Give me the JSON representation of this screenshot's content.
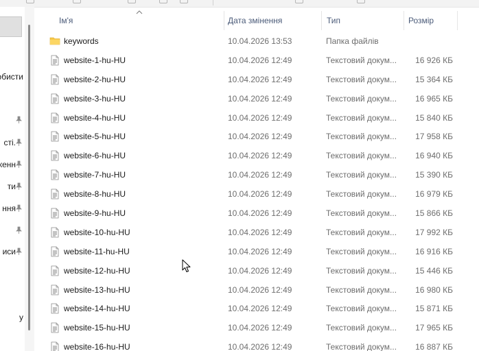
{
  "columns": {
    "name": "Ім'я",
    "date": "Дата змінення",
    "type": "Тип",
    "size": "Розмір"
  },
  "nav": {
    "items": [
      {
        "label": "обисти",
        "pinned": false
      },
      {
        "label": "",
        "pinned": true
      },
      {
        "label": "сті.",
        "pinned": true
      },
      {
        "label": "кенн",
        "pinned": true
      },
      {
        "label": "ти",
        "pinned": true
      },
      {
        "label": "ння",
        "pinned": true
      },
      {
        "label": "",
        "pinned": true
      },
      {
        "label": "иси",
        "pinned": true
      },
      {
        "label": "у",
        "pinned": false
      }
    ]
  },
  "files": [
    {
      "name": "keywords",
      "date": "10.04.2026 13:53",
      "type": "Папка файлів",
      "size": "",
      "kind": "folder"
    },
    {
      "name": "website-1-hu-HU",
      "date": "10.04.2026 12:49",
      "type": "Текстовий докум...",
      "size": "16 926 КБ",
      "kind": "text"
    },
    {
      "name": "website-2-hu-HU",
      "date": "10.04.2026 12:49",
      "type": "Текстовий докум...",
      "size": "15 364 КБ",
      "kind": "text"
    },
    {
      "name": "website-3-hu-HU",
      "date": "10.04.2026 12:49",
      "type": "Текстовий докум...",
      "size": "16 965 КБ",
      "kind": "text"
    },
    {
      "name": "website-4-hu-HU",
      "date": "10.04.2026 12:49",
      "type": "Текстовий докум...",
      "size": "15 840 КБ",
      "kind": "text"
    },
    {
      "name": "website-5-hu-HU",
      "date": "10.04.2026 12:49",
      "type": "Текстовий докум...",
      "size": "17 958 КБ",
      "kind": "text"
    },
    {
      "name": "website-6-hu-HU",
      "date": "10.04.2026 12:49",
      "type": "Текстовий докум...",
      "size": "16 940 КБ",
      "kind": "text"
    },
    {
      "name": "website-7-hu-HU",
      "date": "10.04.2026 12:49",
      "type": "Текстовий докум...",
      "size": "15 390 КБ",
      "kind": "text"
    },
    {
      "name": "website-8-hu-HU",
      "date": "10.04.2026 12:49",
      "type": "Текстовий докум...",
      "size": "16 979 КБ",
      "kind": "text"
    },
    {
      "name": "website-9-hu-HU",
      "date": "10.04.2026 12:49",
      "type": "Текстовий докум...",
      "size": "15 866 КБ",
      "kind": "text"
    },
    {
      "name": "website-10-hu-HU",
      "date": "10.04.2026 12:49",
      "type": "Текстовий докум...",
      "size": "17 992 КБ",
      "kind": "text"
    },
    {
      "name": "website-11-hu-HU",
      "date": "10.04.2026 12:49",
      "type": "Текстовий докум...",
      "size": "16 916 КБ",
      "kind": "text"
    },
    {
      "name": "website-12-hu-HU",
      "date": "10.04.2026 12:49",
      "type": "Текстовий докум...",
      "size": "15 446 КБ",
      "kind": "text"
    },
    {
      "name": "website-13-hu-HU",
      "date": "10.04.2026 12:49",
      "type": "Текстовий докум...",
      "size": "16 980 КБ",
      "kind": "text"
    },
    {
      "name": "website-14-hu-HU",
      "date": "10.04.2026 12:49",
      "type": "Текстовий докум...",
      "size": "15 871 КБ",
      "kind": "text"
    },
    {
      "name": "website-15-hu-HU",
      "date": "10.04.2026 12:49",
      "type": "Текстовий докум...",
      "size": "17 965 КБ",
      "kind": "text"
    },
    {
      "name": "website-16-hu-HU",
      "date": "10.04.2026 12:49",
      "type": "Текстовий докум...",
      "size": "16 887 КБ",
      "kind": "text"
    }
  ],
  "colors": {
    "folder": "#f8c94a",
    "header_text": "#4a5a78",
    "secondary_text": "#6d6d6d"
  }
}
